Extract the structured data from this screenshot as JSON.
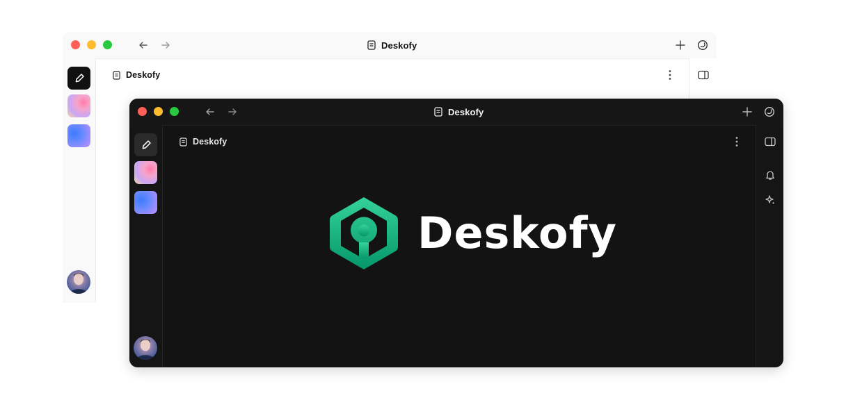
{
  "back_window": {
    "theme": "light",
    "title": "Deskofy",
    "page_title": "Deskofy",
    "nav": {
      "back_icon": "arrow-left-icon",
      "forward_icon": "arrow-right-icon"
    },
    "toolbar": {
      "add_icon": "plus-icon",
      "account_icon": "circle-icon"
    },
    "sidebar": {
      "apps": [
        "pen-app",
        "gradient-pink-app",
        "gradient-blue-app"
      ],
      "avatar": "user-avatar"
    },
    "right_rail": [
      "sidebar-panel-icon"
    ]
  },
  "front_window": {
    "theme": "dark",
    "title": "Deskofy",
    "page_title": "Deskofy",
    "nav": {
      "back_icon": "arrow-left-icon",
      "forward_icon": "arrow-right-icon"
    },
    "toolbar": {
      "add_icon": "plus-icon",
      "account_icon": "circle-icon"
    },
    "sidebar": {
      "apps": [
        "pen-app",
        "gradient-pink-app",
        "gradient-blue-app"
      ],
      "avatar": "user-avatar"
    },
    "right_rail": [
      "sidebar-panel-icon",
      "bell-icon",
      "sparkle-icon"
    ],
    "brand": {
      "name": "Deskofy",
      "logo_icon": "hexagon-pin-logo"
    }
  },
  "colors": {
    "traffic_red": "#ff5f57",
    "traffic_yellow": "#febc2e",
    "traffic_green": "#28c840",
    "brand_green_light": "#34d399",
    "brand_green_dark": "#059669",
    "dark_bg": "#131313"
  }
}
